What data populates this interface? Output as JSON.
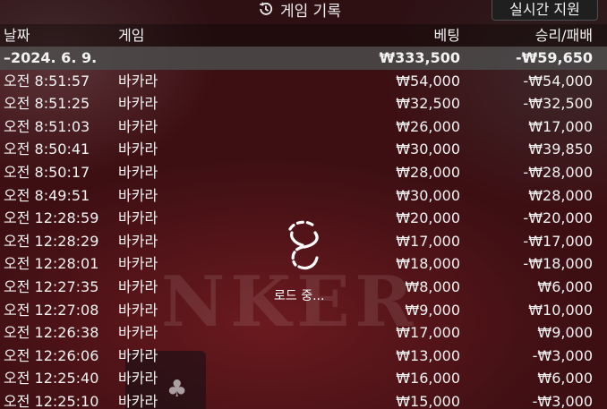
{
  "header": {
    "title": "게임 기록",
    "live_support_label": "실시간 지원"
  },
  "columns": {
    "date": "날짜",
    "game": "게임",
    "bet": "베팅",
    "result": "승리/패배"
  },
  "summary": {
    "date": "–2024. 6. 9.",
    "bet": "₩333,500",
    "result": "-₩59,650"
  },
  "rows": [
    {
      "time": "오전 8:51:57",
      "game": "바카라",
      "bet": "₩54,000",
      "result": "-₩54,000"
    },
    {
      "time": "오전 8:51:25",
      "game": "바카라",
      "bet": "₩32,500",
      "result": "-₩32,500"
    },
    {
      "time": "오전 8:51:03",
      "game": "바카라",
      "bet": "₩26,000",
      "result": "₩17,000"
    },
    {
      "time": "오전 8:50:41",
      "game": "바카라",
      "bet": "₩30,000",
      "result": "₩39,850"
    },
    {
      "time": "오전 8:50:17",
      "game": "바카라",
      "bet": "₩28,000",
      "result": "-₩28,000"
    },
    {
      "time": "오전 8:49:51",
      "game": "바카라",
      "bet": "₩30,000",
      "result": "₩28,000"
    },
    {
      "time": "오전 12:28:59",
      "game": "바카라",
      "bet": "₩20,000",
      "result": "-₩20,000"
    },
    {
      "time": "오전 12:28:29",
      "game": "바카라",
      "bet": "₩17,000",
      "result": "-₩17,000"
    },
    {
      "time": "오전 12:28:01",
      "game": "바카라",
      "bet": "₩18,000",
      "result": "-₩18,000"
    },
    {
      "time": "오전 12:27:35",
      "game": "바카라",
      "bet": "₩8,000",
      "result": "₩6,000"
    },
    {
      "time": "오전 12:27:08",
      "game": "바카라",
      "bet": "₩9,000",
      "result": "₩10,000"
    },
    {
      "time": "오전 12:26:38",
      "game": "바카라",
      "bet": "₩17,000",
      "result": "₩9,000"
    },
    {
      "time": "오전 12:26:06",
      "game": "바카라",
      "bet": "₩13,000",
      "result": "-₩3,000"
    },
    {
      "time": "오전 12:25:40",
      "game": "바카라",
      "bet": "₩16,000",
      "result": "₩6,000"
    },
    {
      "time": "오전 12:25:10",
      "game": "바카라",
      "bet": "₩15,000",
      "result": "-₩3,000"
    }
  ],
  "background_text": "NKER",
  "loading": {
    "label": "로드 중..."
  },
  "icons": {
    "title_icon": "history-icon",
    "loader_icon": "spinner-icon"
  }
}
